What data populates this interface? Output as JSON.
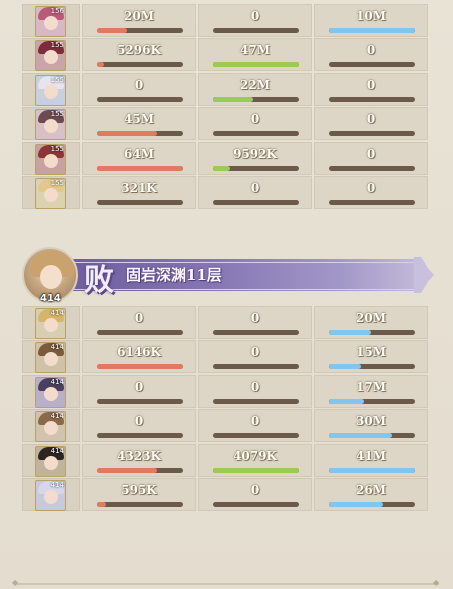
{
  "group_top": {
    "rows": [
      {
        "avatar": "hero-avatar-pink-hair",
        "hair_color": "#b85a78",
        "bg": "#d8b8c6",
        "level": "156",
        "c1": {
          "text": "20M",
          "fill": 0.35,
          "color": "red"
        },
        "c2": {
          "text": "0",
          "fill": 0,
          "color": "green"
        },
        "c3": {
          "text": "10M",
          "fill": 1.0,
          "color": "blue"
        }
      },
      {
        "avatar": "hero-avatar-dark-red-hair",
        "hair_color": "#7b2e3a",
        "bg": "#c9a5a8",
        "level": "155",
        "c1": {
          "text": "5296K",
          "fill": 0.08,
          "color": "red"
        },
        "c2": {
          "text": "47M",
          "fill": 1.0,
          "color": "green"
        },
        "c3": {
          "text": "0",
          "fill": 0,
          "color": "blue"
        }
      },
      {
        "avatar": "hero-avatar-white-hair",
        "hair_color": "#e8e4ee",
        "bg": "#c8d0e0",
        "level": "155",
        "c1": {
          "text": "0",
          "fill": 0,
          "color": "red"
        },
        "c2": {
          "text": "22M",
          "fill": 0.47,
          "color": "green"
        },
        "c3": {
          "text": "0",
          "fill": 0,
          "color": "blue"
        }
      },
      {
        "avatar": "hero-avatar-brown-hair-girl",
        "hair_color": "#6d4a52",
        "bg": "#d7c0c6",
        "level": "155",
        "c1": {
          "text": "45M",
          "fill": 0.7,
          "color": "red"
        },
        "c2": {
          "text": "0",
          "fill": 0,
          "color": "green"
        },
        "c3": {
          "text": "0",
          "fill": 0,
          "color": "blue"
        }
      },
      {
        "avatar": "hero-avatar-crimson-hair",
        "hair_color": "#8c3438",
        "bg": "#c8a2a0",
        "level": "155",
        "c1": {
          "text": "64M",
          "fill": 1.0,
          "color": "red"
        },
        "c2": {
          "text": "9592K",
          "fill": 0.2,
          "color": "green"
        },
        "c3": {
          "text": "0",
          "fill": 0,
          "color": "blue"
        }
      },
      {
        "avatar": "hero-avatar-blonde-hair",
        "hair_color": "#e2c98a",
        "bg": "#dcd2b0",
        "level": "155",
        "c1": {
          "text": "321K",
          "fill": 0,
          "color": "red"
        },
        "c2": {
          "text": "0",
          "fill": 0,
          "color": "green"
        },
        "c3": {
          "text": "0",
          "fill": 0,
          "color": "blue"
        }
      }
    ]
  },
  "banner": {
    "portrait_icon": "enemy-boss-portrait",
    "portrait_number": "414",
    "result_label": "败",
    "stage_name": "固岩深渊11层"
  },
  "group_bottom": {
    "rows": [
      {
        "avatar": "enemy-avatar-blonde-armored",
        "hair_color": "#d6b46a",
        "bg": "#d8ceb4",
        "level": "414",
        "c1": {
          "text": "0",
          "fill": 0,
          "color": "red"
        },
        "c2": {
          "text": "0",
          "fill": 0,
          "color": "green"
        },
        "c3": {
          "text": "20M",
          "fill": 0.49,
          "color": "blue"
        }
      },
      {
        "avatar": "enemy-avatar-brown-warrior",
        "hair_color": "#7a5c3a",
        "bg": "#cfc2a8",
        "level": "414",
        "c1": {
          "text": "6146K",
          "fill": 1.0,
          "color": "red"
        },
        "c2": {
          "text": "0",
          "fill": 0,
          "color": "green"
        },
        "c3": {
          "text": "15M",
          "fill": 0.37,
          "color": "blue"
        }
      },
      {
        "avatar": "enemy-avatar-dark-hood",
        "hair_color": "#4a3f5c",
        "bg": "#b8b0c8",
        "level": "414",
        "c1": {
          "text": "0",
          "fill": 0,
          "color": "red"
        },
        "c2": {
          "text": "0",
          "fill": 0,
          "color": "green"
        },
        "c3": {
          "text": "17M",
          "fill": 0.41,
          "color": "blue"
        }
      },
      {
        "avatar": "enemy-avatar-sage",
        "hair_color": "#8a6a4a",
        "bg": "#d2c4ac",
        "level": "414",
        "c1": {
          "text": "0",
          "fill": 0,
          "color": "red"
        },
        "c2": {
          "text": "0",
          "fill": 0,
          "color": "green"
        },
        "c3": {
          "text": "30M",
          "fill": 0.73,
          "color": "blue"
        }
      },
      {
        "avatar": "enemy-avatar-black-hair",
        "hair_color": "#2c2522",
        "bg": "#c2b49c",
        "level": "414",
        "c1": {
          "text": "4323K",
          "fill": 0.7,
          "color": "red"
        },
        "c2": {
          "text": "4079K",
          "fill": 1.0,
          "color": "green"
        },
        "c3": {
          "text": "41M",
          "fill": 1.0,
          "color": "blue"
        }
      },
      {
        "avatar": "enemy-avatar-silver-mage",
        "hair_color": "#d6d8ea",
        "bg": "#c6cadc",
        "level": "414",
        "c1": {
          "text": "595K",
          "fill": 0.1,
          "color": "red"
        },
        "c2": {
          "text": "0",
          "fill": 0,
          "color": "green"
        },
        "c3": {
          "text": "26M",
          "fill": 0.63,
          "color": "blue"
        }
      }
    ]
  }
}
